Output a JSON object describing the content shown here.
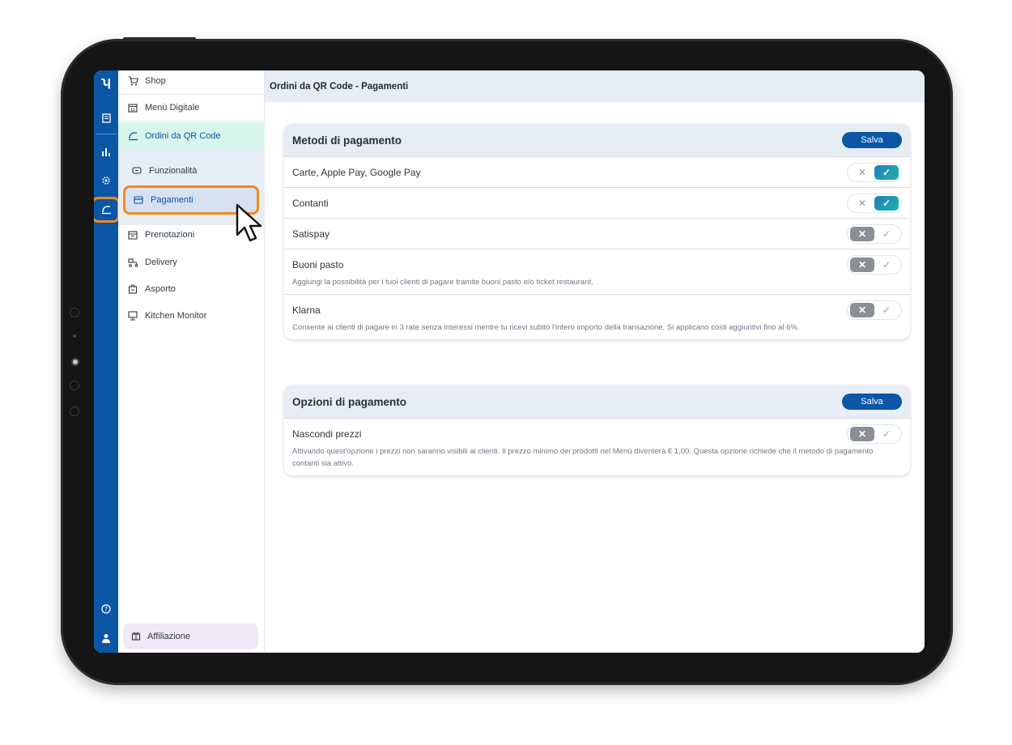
{
  "rail": {
    "icons": [
      "logo-icon",
      "menu-icon",
      "chart-icon",
      "settings-icon",
      "qr-order-icon",
      "help-icon",
      "user-icon"
    ]
  },
  "sidebar": {
    "items": [
      {
        "label": "Shop",
        "icon": "cart-icon"
      },
      {
        "label": "Menù Digitale",
        "icon": "calendar-icon"
      },
      {
        "label": "Ordini da QR Code",
        "icon": "qr-order-icon"
      },
      {
        "label": "Prenotazioni",
        "icon": "reservation-icon"
      },
      {
        "label": "Delivery",
        "icon": "scooter-icon"
      },
      {
        "label": "Asporto",
        "icon": "bag-icon"
      },
      {
        "label": "Kitchen Monitor",
        "icon": "monitor-icon"
      }
    ],
    "subitems": [
      {
        "label": "Funzionalità",
        "icon": "feature-icon"
      },
      {
        "label": "Pagamenti",
        "icon": "card-icon"
      }
    ],
    "affiliate_label": "Affiliazione"
  },
  "header": {
    "title": "Ordini da QR Code - Pagamenti"
  },
  "payment_methods": {
    "title": "Metodi di pagamento",
    "save_label": "Salva",
    "rows": [
      {
        "label": "Carte, Apple Pay, Google Pay",
        "enabled": true,
        "description": ""
      },
      {
        "label": "Contanti",
        "enabled": true,
        "description": ""
      },
      {
        "label": "Satispay",
        "enabled": false,
        "description": ""
      },
      {
        "label": "Buoni pasto",
        "enabled": false,
        "description": "Aggiungi la possibilità per i tuoi clienti di pagare tramite buoni pasto e/o ticket restaurant."
      },
      {
        "label": "Klarna",
        "enabled": false,
        "description": "Consente ai clienti di pagare in 3 rate senza interessi mentre tu ricevi subito l'intero importo della transazione. Si applicano costi aggiuntivi fino al 6%."
      }
    ]
  },
  "payment_options": {
    "title": "Opzioni di pagamento",
    "save_label": "Salva",
    "rows": [
      {
        "label": "Nascondi prezzi",
        "enabled": false,
        "description": "Attivando quest'opzione i prezzi non saranno visibili ai clienti. Il prezzo minimo dei prodotti nel Menù diventerà € 1,00. Questa opzione richiede che il metodo di pagamento contanti sia attivo."
      }
    ]
  },
  "toggle_glyphs": {
    "off": "✕",
    "on": "✓"
  },
  "colors": {
    "brand_blue": "#0b56a5",
    "highlight_orange": "#f08a1e",
    "active_green_bg": "#d7f5ea"
  }
}
